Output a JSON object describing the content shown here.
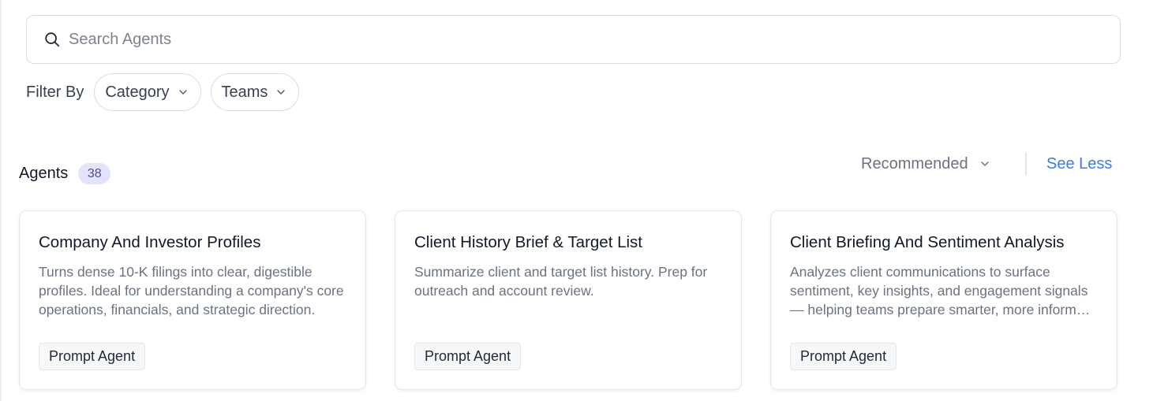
{
  "search": {
    "placeholder": "Search Agents",
    "value": "",
    "icon": "search-icon"
  },
  "filters": {
    "label": "Filter By",
    "options": [
      {
        "label": "Category",
        "icon": "chevron-down-icon"
      },
      {
        "label": "Teams",
        "icon": "chevron-down-icon"
      }
    ]
  },
  "agents": {
    "title": "Agents",
    "count": "38",
    "sort_label": "Recommended",
    "toggle_label": "See Less"
  },
  "cards": [
    {
      "title": "Company And Investor Profiles",
      "description": "Turns dense 10-K filings into clear, digestible profiles. Ideal for understanding a company's core operations, financials, and strategic direction.",
      "tag": "Prompt Agent"
    },
    {
      "title": "Client History Brief & Target List",
      "description": "Summarize client and target list history. Prep for outreach and account review.",
      "tag": "Prompt Agent"
    },
    {
      "title": "Client Briefing And Sentiment Analysis",
      "description": "Analyzes client communications to surface sentiment, key insights, and engagement signals — helping teams prepare smarter, more informed meetings.",
      "tag": "Prompt Agent"
    }
  ],
  "colors": {
    "accent": "#3d7be0",
    "badge_bg": "#e3e4fb",
    "badge_text": "#4b4f8c"
  }
}
